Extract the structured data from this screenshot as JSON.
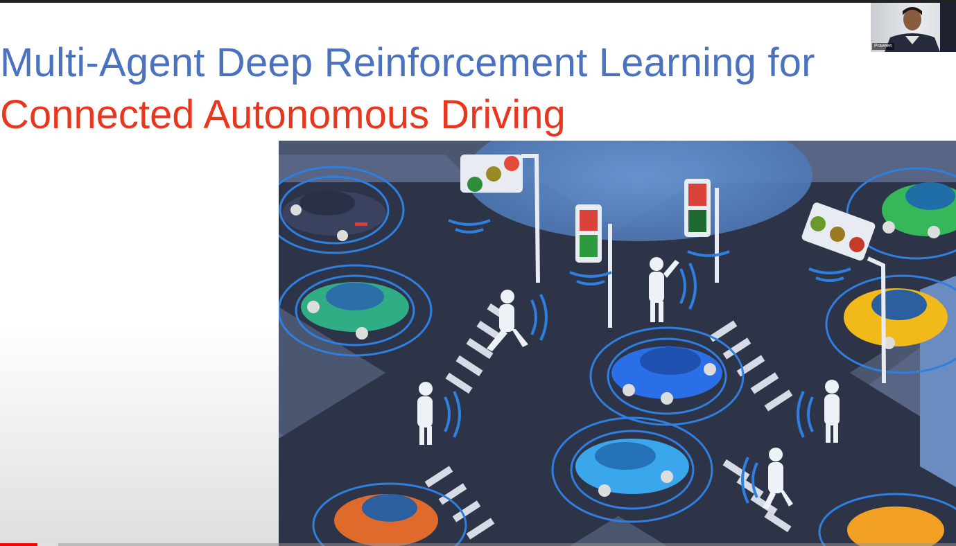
{
  "slide": {
    "title_line1": "Multi-Agent Deep Reinforcement Learning for",
    "title_line2": "Connected Autonomous Driving",
    "title_line1_color": "#4a72bf",
    "title_line2_color": "#e8371f"
  },
  "webcam": {
    "presenter_name": "Praveen"
  },
  "player": {
    "progress_color": "#ff0000",
    "progress_fraction": 0.039,
    "buffered_fraction": 0.061
  },
  "illustration": {
    "subject": "smart-city-intersection",
    "icons": [
      "car-icon",
      "pedestrian-icon",
      "traffic-light-icon",
      "crosswalk-signal-icon",
      "signal-wave-icon"
    ]
  }
}
